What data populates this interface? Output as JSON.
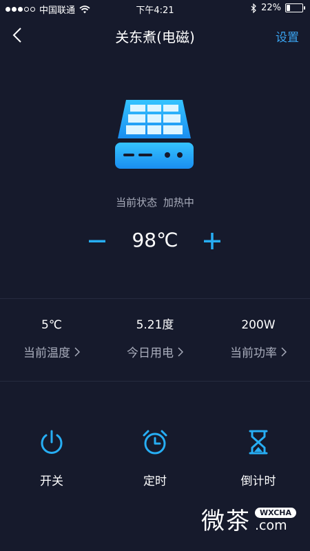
{
  "status_bar": {
    "carrier": "中国联通",
    "time": "下午4:21",
    "battery_percent": "22%",
    "battery_level": 0.22
  },
  "nav": {
    "title": "关东煮(电磁)",
    "settings": "设置"
  },
  "device": {
    "status_label": "当前状态",
    "status_value": "加热中"
  },
  "temp_control": {
    "value": "98℃"
  },
  "stats": [
    {
      "value": "5℃",
      "label": "当前温度"
    },
    {
      "value": "5.21度",
      "label": "今日用电"
    },
    {
      "value": "200W",
      "label": "当前功率"
    }
  ],
  "actions": [
    {
      "label": "开关",
      "icon": "power-icon"
    },
    {
      "label": "定时",
      "icon": "alarm-clock-icon"
    },
    {
      "label": "倒计时",
      "icon": "hourglass-icon"
    }
  ],
  "watermark": {
    "cn": "微茶",
    "badge": "WXCHA",
    "com": ".com"
  },
  "colors": {
    "background": "#161a2c",
    "accent": "#27aef4",
    "link": "#3aa2ee",
    "muted_text": "#a9adbc"
  }
}
